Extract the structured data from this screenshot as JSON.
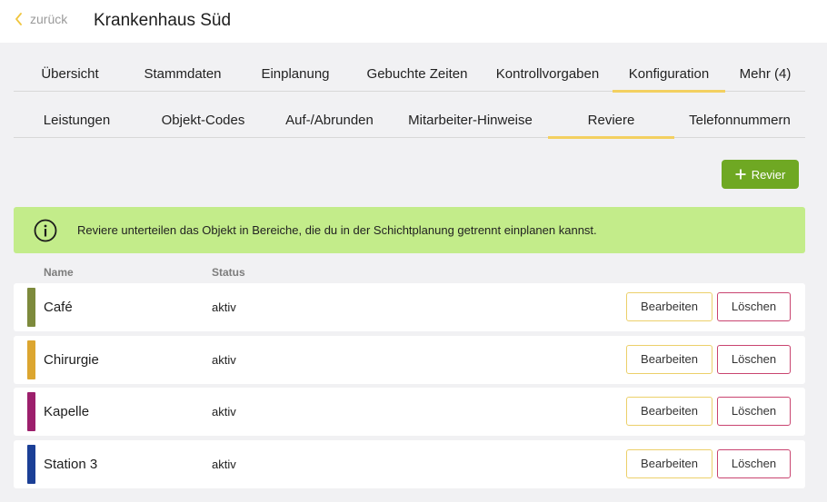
{
  "header": {
    "back_label": "zurück",
    "title": "Krankenhaus Süd"
  },
  "tabs_primary": [
    {
      "label": "Übersicht",
      "active": false
    },
    {
      "label": "Stammdaten",
      "active": false
    },
    {
      "label": "Einplanung",
      "active": false
    },
    {
      "label": "Gebuchte Zeiten",
      "active": false
    },
    {
      "label": "Kontrollvorgaben",
      "active": false
    },
    {
      "label": "Konfiguration",
      "active": true
    },
    {
      "label": "Mehr (4)",
      "active": false
    }
  ],
  "tabs_secondary": [
    {
      "label": "Leistungen",
      "active": false
    },
    {
      "label": "Objekt-Codes",
      "active": false
    },
    {
      "label": "Auf-/Abrunden",
      "active": false
    },
    {
      "label": "Mitarbeiter-Hinweise",
      "active": false
    },
    {
      "label": "Reviere",
      "active": true
    },
    {
      "label": "Telefonnummern",
      "active": false
    }
  ],
  "add_button": {
    "icon": "plus-icon",
    "label": "Revier"
  },
  "info": {
    "icon": "info-icon",
    "text": "Reviere unterteilen das Objekt in Bereiche, die du in der Schichtplanung getrennt einplanen kannst."
  },
  "table": {
    "columns": {
      "name": "Name",
      "status": "Status"
    },
    "rows": [
      {
        "name": "Café",
        "status": "aktiv",
        "color": "#7d8a3c",
        "edit_label": "Bearbeiten",
        "delete_label": "Löschen"
      },
      {
        "name": "Chirurgie",
        "status": "aktiv",
        "color": "#dca630",
        "edit_label": "Bearbeiten",
        "delete_label": "Löschen"
      },
      {
        "name": "Kapelle",
        "status": "aktiv",
        "color": "#9c1f6c",
        "edit_label": "Bearbeiten",
        "delete_label": "Löschen"
      },
      {
        "name": "Station 3",
        "status": "aktiv",
        "color": "#1b3f96",
        "edit_label": "Bearbeiten",
        "delete_label": "Löschen"
      }
    ]
  },
  "colors": {
    "accent_tab": "#f3d060",
    "add_button_bg": "#6fa823",
    "info_bg": "#c3ec8a",
    "edit_border": "#ecd06a",
    "delete_border": "#c94470"
  }
}
